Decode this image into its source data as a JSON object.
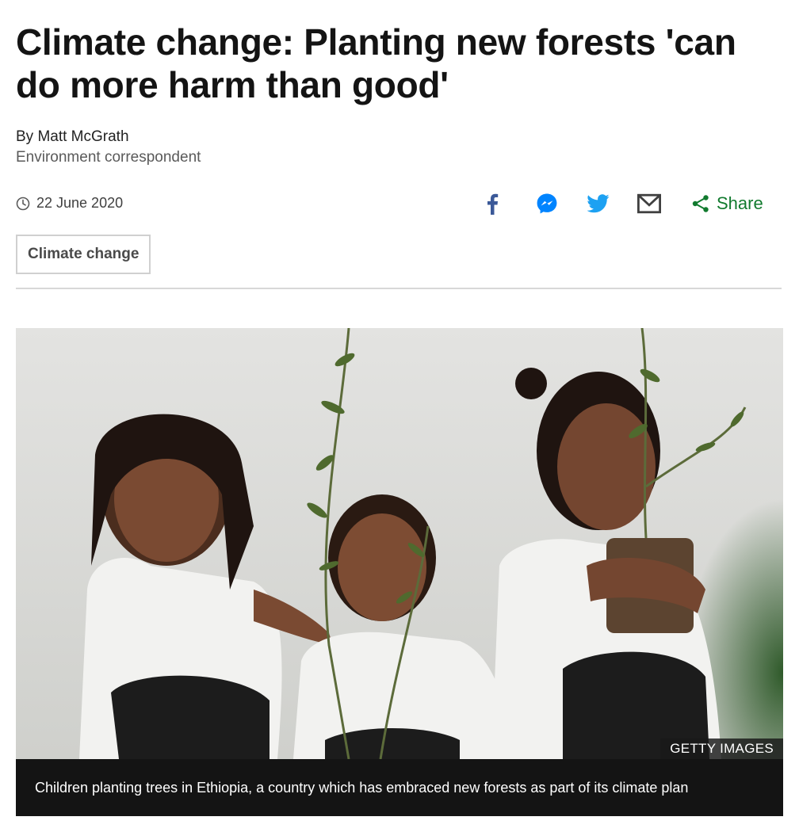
{
  "article": {
    "headline": "Climate change: Planting new forests 'can do more harm than good'",
    "author": "By Matt McGrath",
    "role": "Environment correspondent",
    "date": "22 June 2020",
    "topic_tag": "Climate change"
  },
  "share": {
    "icons": [
      "facebook-icon",
      "messenger-icon",
      "twitter-icon",
      "email-icon"
    ],
    "share_label": "Share",
    "colors": {
      "facebook": "#3b5998",
      "messenger": "#0084ff",
      "twitter": "#1da1f2",
      "email": "#404040",
      "share": "#117a2e"
    }
  },
  "figure": {
    "credit": "GETTY IMAGES",
    "caption": "Children planting trees in Ethiopia, a country which has embraced new forests as part of its climate plan"
  }
}
